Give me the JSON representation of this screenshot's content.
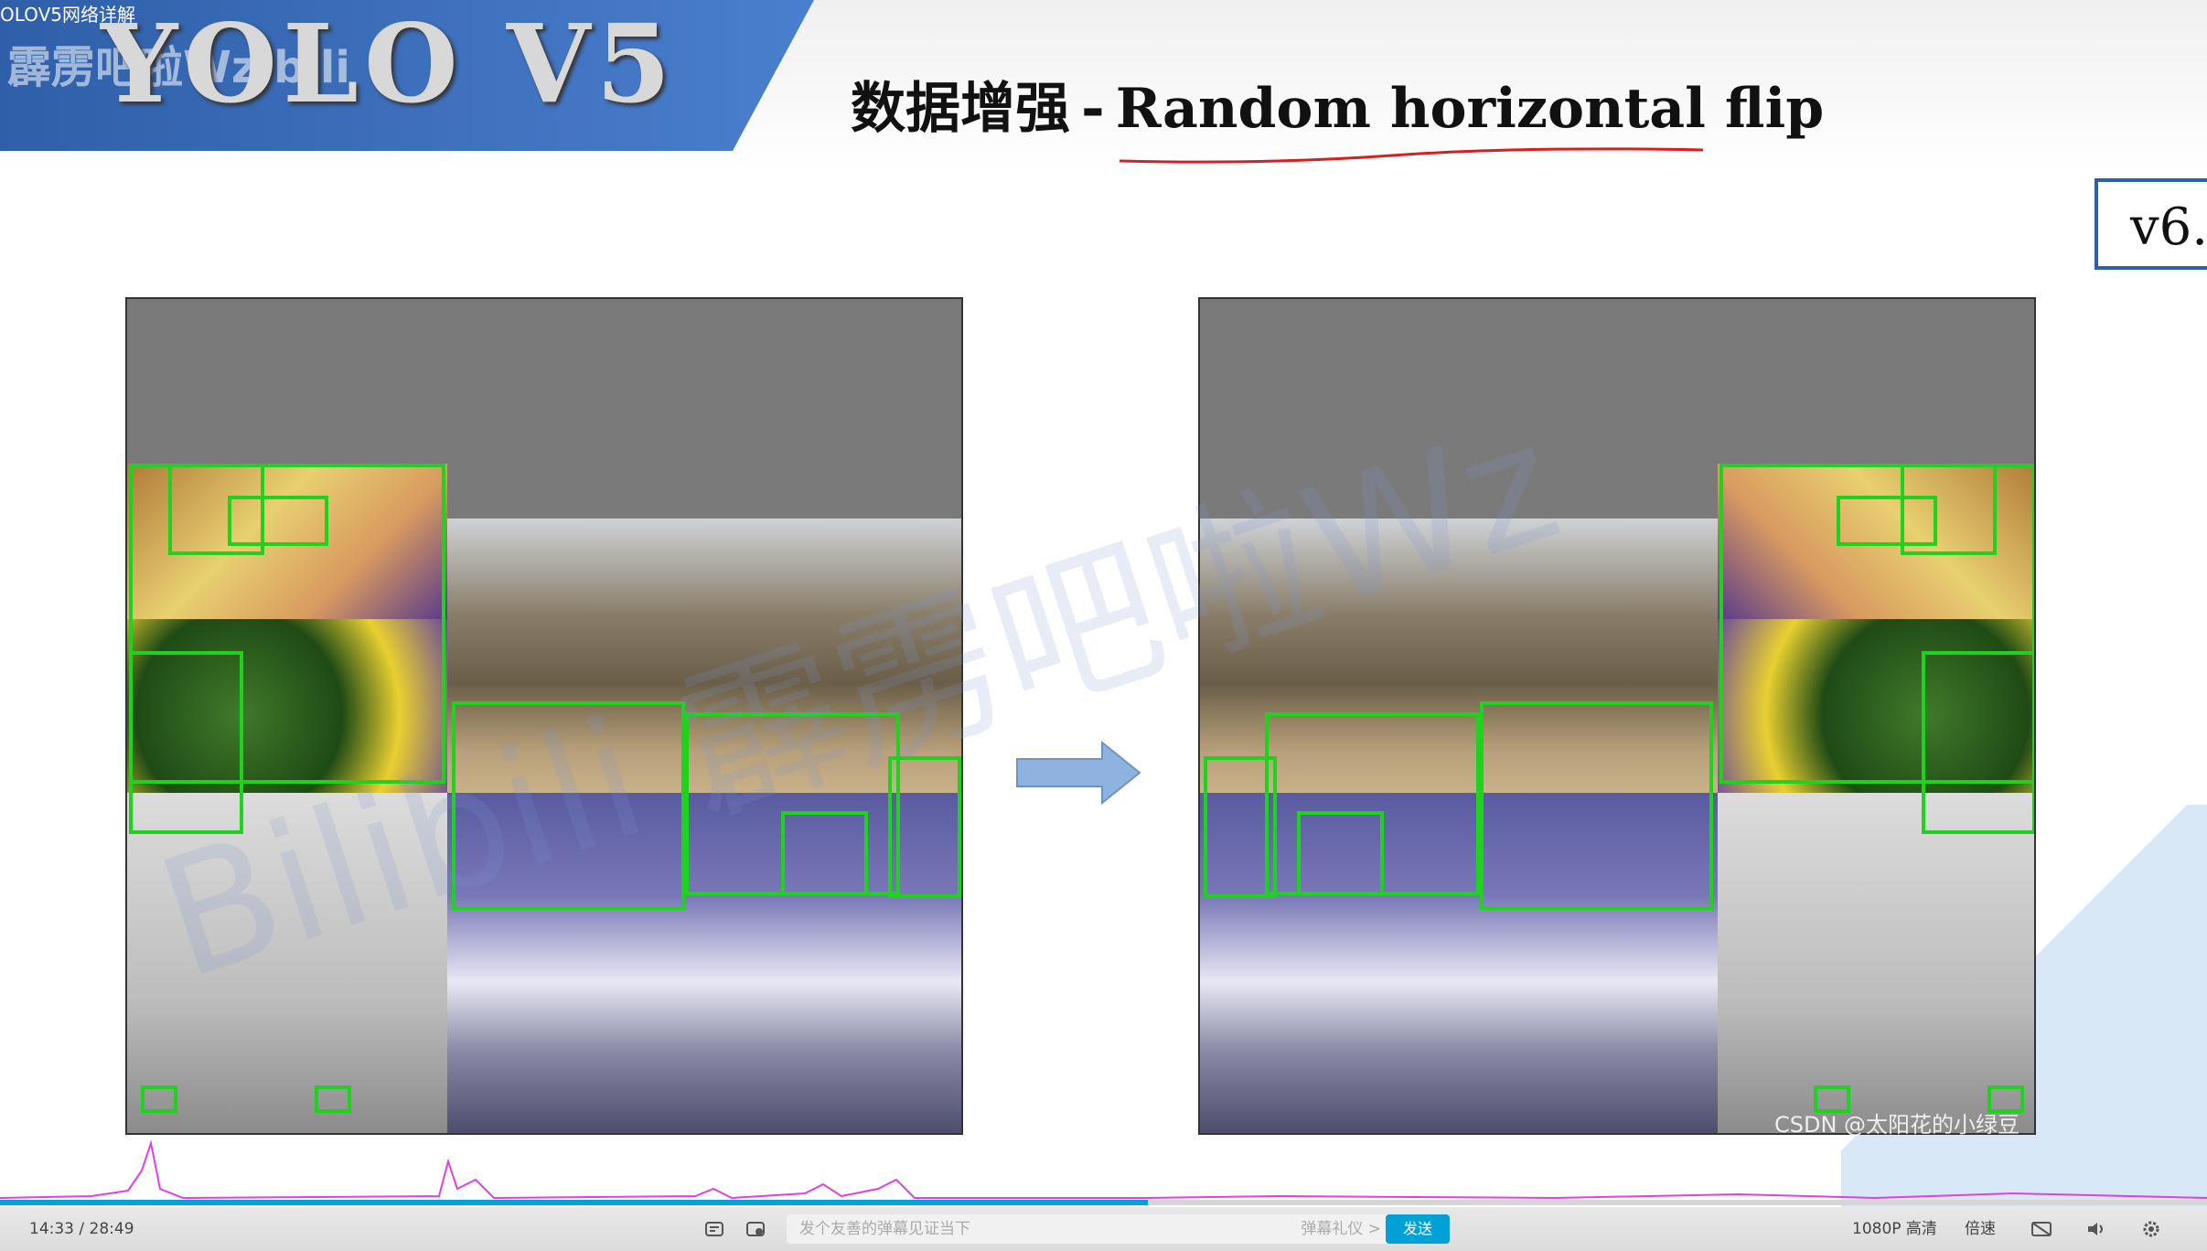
{
  "window": {
    "title": "OLOV5网络详解"
  },
  "logo": {
    "text": "YOLO V5",
    "watermark": "霹雳吧啦Wz·bili"
  },
  "slide": {
    "title_cn": "数据增强",
    "title_sep": "-",
    "title_en": "Random horizontal flip",
    "version_badge": "v6.",
    "watermark": "Bilibili 霹雳吧啦Wz",
    "credit": "CSDN @太阳花的小绿豆",
    "arrow_color": "#8fb3e0",
    "box_color": "#1ed21e"
  },
  "player": {
    "time_current": "14:33",
    "time_separator": "/",
    "time_total": "28:49",
    "progress_fraction": 0.52,
    "danmaku_placeholder": "发个友善的弹幕见证当下",
    "danmaku_etiquette": "弹幕礼仪 >",
    "send_label": "发送",
    "quality_label": "1080P 高清",
    "speed_label": "倍速",
    "accent_color": "#00a1d6",
    "icons": [
      "danmaku-toggle-icon",
      "danmaku-settings-icon",
      "subtitle-icon",
      "volume-icon",
      "settings-icon"
    ]
  }
}
